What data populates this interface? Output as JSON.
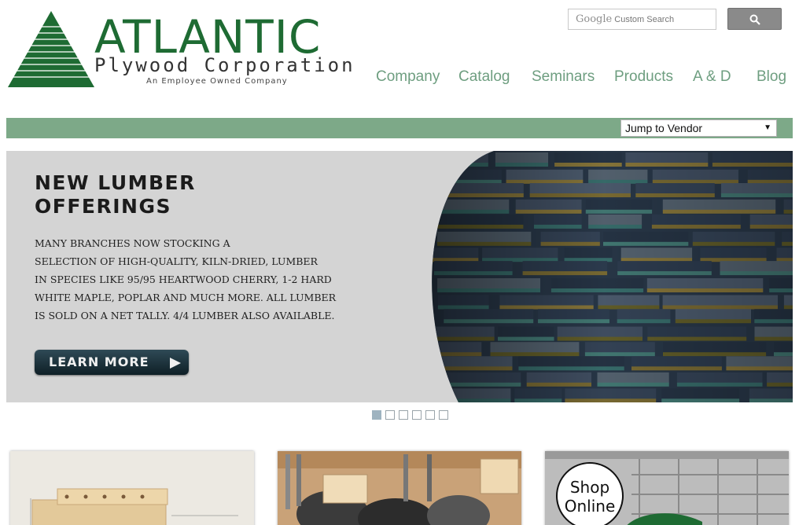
{
  "logo": {
    "name": "ATLANTIC",
    "subtitle": "Plywood Corporation",
    "tagline": "An Employee Owned Company"
  },
  "search": {
    "google_mark": "Google",
    "placeholder": "Custom Search",
    "button_icon": "magnifier-icon"
  },
  "nav": {
    "items": [
      "Company",
      "Catalog",
      "Seminars",
      "Products",
      "A & D",
      "Blog"
    ],
    "color": "#6e9e80"
  },
  "vendor_select": {
    "value": "Jump to Vendor"
  },
  "brand_colors": {
    "green": "#1e6b33",
    "bar": "#7da988"
  },
  "hero": {
    "title_line1": "NEW LUMBER",
    "title_line2": "OFFERINGS",
    "body_lines": [
      "MANY BRANCHES NOW STOCKING A",
      "SELECTION OF HIGH-QUALITY, KILN-DRIED,  LUMBER",
      "IN SPECIES LIKE 95/95 HEARTWOOD CHERRY, 1-2 HARD",
      "WHITE MAPLE, POPLAR AND MUCH MORE. ALL LUMBER",
      "IS SOLD ON A NET TALLY. 4/4 LUMBER ALSO AVAILABLE."
    ],
    "button_label": "LEARN MORE"
  },
  "slider": {
    "total": 6,
    "active": 1
  },
  "tiles": {
    "shop_line1": "Shop",
    "shop_line2": "Online"
  }
}
